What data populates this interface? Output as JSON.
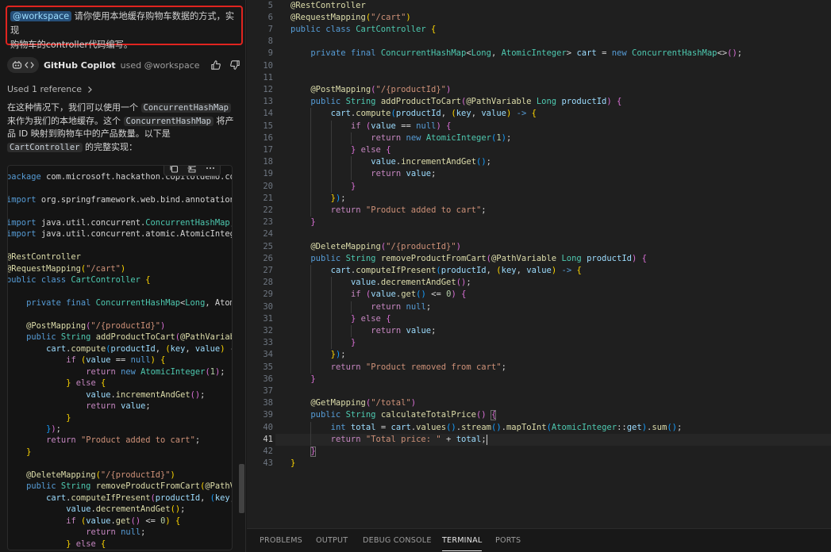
{
  "chat": {
    "request_mention": "@workspace",
    "request_text_1": " 请你使用本地缓存购物车数据的方式，实现",
    "request_text_2": "购物车的controller代码编写。",
    "agent_name": "GitHub Copilot",
    "agent_used": "used @workspace",
    "reference_label": "Used 1 reference",
    "answer": {
      "p1": "在这种情况下，我们可以使用一个 ",
      "c1": "ConcurrentHashMap",
      "p2": "来作为我们的本地缓存。这个 ",
      "c2": "ConcurrentHashMap",
      "p3": " 将产",
      "p4": "品 ID 映射到购物车中的产品数量。以下是",
      "c3": "CartController",
      "p5": " 的完整实现："
    }
  },
  "chat_code": [
    "package com.microsoft.hackathon.copilotdemo.co",
    "",
    "import org.springframework.web.bind.annotation",
    "",
    "import java.util.concurrent.ConcurrentHashMap;",
    "import java.util.concurrent.atomic.AtomicInteg",
    "",
    "@RestController",
    "@RequestMapping(\"/cart\")",
    "public class CartController {",
    "",
    "    private final ConcurrentHashMap<Long, Atom",
    "",
    "    @PostMapping(\"/{productId}\")",
    "    public String addProductToCart(@PathVariab",
    "        cart.compute(productId, (key, value) -",
    "            if (value == null) {",
    "                return new AtomicInteger(1);",
    "            } else {",
    "                value.incrementAndGet();",
    "                return value;",
    "            }",
    "        });",
    "        return \"Product added to cart\";",
    "    }",
    "",
    "    @DeleteMapping(\"/{productId}\")",
    "    public String removeProductFromCart(@PathV",
    "        cart.computeIfPresent(productId, (key,",
    "            value.decrementAndGet();",
    "            if (value.get() <= 0) {",
    "                return null;",
    "            } else {"
  ],
  "editor": {
    "current_line": 41,
    "lines": [
      {
        "n": 5,
        "text": "@RestController"
      },
      {
        "n": 6,
        "text": "@RequestMapping(\"/cart\")"
      },
      {
        "n": 7,
        "text": "public class CartController {"
      },
      {
        "n": 8,
        "text": ""
      },
      {
        "n": 9,
        "text": "    private final ConcurrentHashMap<Long, AtomicInteger> cart = new ConcurrentHashMap<>();"
      },
      {
        "n": 10,
        "text": ""
      },
      {
        "n": 11,
        "text": ""
      },
      {
        "n": 12,
        "text": "    @PostMapping(\"/{productId}\")"
      },
      {
        "n": 13,
        "text": "    public String addProductToCart(@PathVariable Long productId) {"
      },
      {
        "n": 14,
        "text": "        cart.compute(productId, (key, value) -> {"
      },
      {
        "n": 15,
        "text": "            if (value == null) {"
      },
      {
        "n": 16,
        "text": "                return new AtomicInteger(1);"
      },
      {
        "n": 17,
        "text": "            } else {"
      },
      {
        "n": 18,
        "text": "                value.incrementAndGet();"
      },
      {
        "n": 19,
        "text": "                return value;"
      },
      {
        "n": 20,
        "text": "            }"
      },
      {
        "n": 21,
        "text": "        });"
      },
      {
        "n": 22,
        "text": "        return \"Product added to cart\";"
      },
      {
        "n": 23,
        "text": "    }"
      },
      {
        "n": 24,
        "text": ""
      },
      {
        "n": 25,
        "text": "    @DeleteMapping(\"/{productId}\")"
      },
      {
        "n": 26,
        "text": "    public String removeProductFromCart(@PathVariable Long productId) {"
      },
      {
        "n": 27,
        "text": "        cart.computeIfPresent(productId, (key, value) -> {"
      },
      {
        "n": 28,
        "text": "            value.decrementAndGet();"
      },
      {
        "n": 29,
        "text": "            if (value.get() <= 0) {"
      },
      {
        "n": 30,
        "text": "                return null;"
      },
      {
        "n": 31,
        "text": "            } else {"
      },
      {
        "n": 32,
        "text": "                return value;"
      },
      {
        "n": 33,
        "text": "            }"
      },
      {
        "n": 34,
        "text": "        });"
      },
      {
        "n": 35,
        "text": "        return \"Product removed from cart\";"
      },
      {
        "n": 36,
        "text": "    }"
      },
      {
        "n": 37,
        "text": ""
      },
      {
        "n": 38,
        "text": "    @GetMapping(\"/total\")"
      },
      {
        "n": 39,
        "text": "    public String calculateTotalPrice() {"
      },
      {
        "n": 40,
        "text": "        int total = cart.values().stream().mapToInt(AtomicInteger::get).sum();"
      },
      {
        "n": 41,
        "text": "        return \"Total price: \" + total;"
      },
      {
        "n": 42,
        "text": "    }"
      },
      {
        "n": 43,
        "text": "}"
      }
    ]
  },
  "panel_tabs": [
    {
      "label": "PROBLEMS",
      "active": false
    },
    {
      "label": "OUTPUT",
      "active": false
    },
    {
      "label": "DEBUG CONSOLE",
      "active": false
    },
    {
      "label": "TERMINAL",
      "active": true
    },
    {
      "label": "PORTS",
      "active": false
    }
  ],
  "icons": [
    "copilot-icon",
    "code-icon",
    "thumbs-up-icon",
    "thumbs-down-icon",
    "chevron-right-icon",
    "copy-icon",
    "insert-icon",
    "more-icon"
  ],
  "colors": {
    "request_border": "#e0241f",
    "annotation": "#dcdcaa",
    "keyword": "#569cd6",
    "type": "#4ec9b0",
    "string": "#ce9178",
    "variable": "#9cdcfe"
  }
}
